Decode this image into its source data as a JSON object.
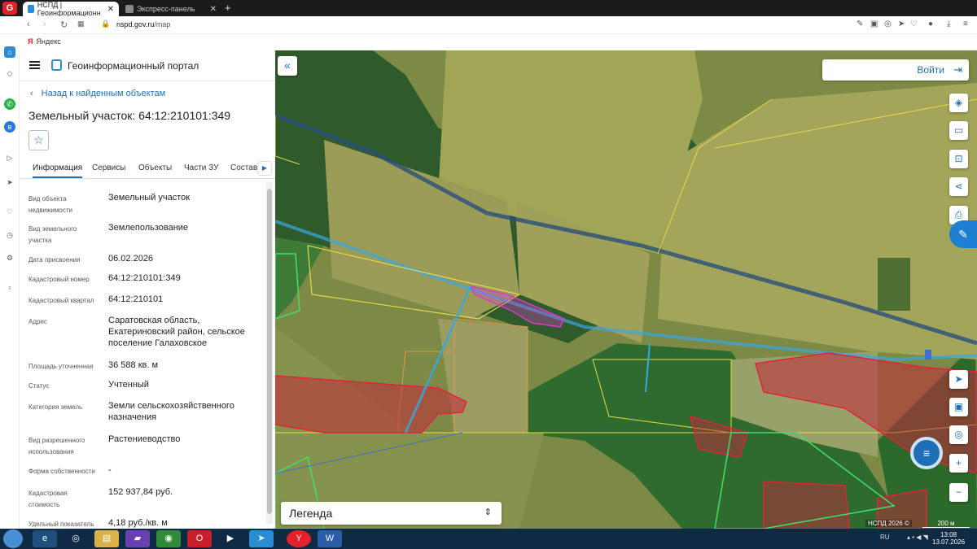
{
  "browser": {
    "tabs": [
      {
        "label": "НСПД | Геоинформационн"
      },
      {
        "label": "Экспресс-панель"
      }
    ],
    "url_host": "nspd.gov.ru",
    "url_path": "/map",
    "bookmark": "Яндекс"
  },
  "panel": {
    "portal_title": "Геоинформационный портал",
    "back_label": "Назад к найденным объектам",
    "object_title": "Земельный участок: 64:12:210101:349",
    "tabs": [
      "Информация",
      "Сервисы",
      "Объекты",
      "Части ЗУ",
      "Состав"
    ],
    "properties": [
      {
        "key": "Вид объекта недвижимости",
        "value": "Земельный участок"
      },
      {
        "key": "Вид земельного участка",
        "value": "Землепользование"
      },
      {
        "key": "Дата присвоения",
        "value": "06.02.2026"
      },
      {
        "key": "Кадастровый номер",
        "value": "64:12:210101:349"
      },
      {
        "key": "Кадастровый квартал",
        "value": "64:12:210101"
      },
      {
        "key": "Адрес",
        "value": "Саратовская область, Екатериновский район, сельское поселение Галаховское"
      },
      {
        "key": "Площадь уточненная",
        "value": "36 588 кв. м"
      },
      {
        "key": "Статус",
        "value": "Учтенный"
      },
      {
        "key": "Категория земель",
        "value": "Земли сельскохозяйственного назначения"
      },
      {
        "key": "Вид разрешенного использования",
        "value": "Растениеводство"
      },
      {
        "key": "Форма собственности",
        "value": "-"
      },
      {
        "key": "Кадастровая стоимость",
        "value": "152 937,84 руб."
      },
      {
        "key": "Удельный показатель",
        "value": "4,18 руб./кв. м"
      }
    ]
  },
  "map": {
    "login_label": "Войти",
    "legend_label": "Легенда",
    "copyright": "НСПД 2026 ©",
    "scale_label": "200 м"
  },
  "taskbar": {
    "lang": "RU",
    "time": "13:08",
    "date": "13.07.2026"
  },
  "colors": {
    "accent": "#1e6fb8",
    "parcel_red": "#e0243a",
    "parcel_selected": "#d63cc8",
    "boundary_blue": "#3aa6e0"
  }
}
